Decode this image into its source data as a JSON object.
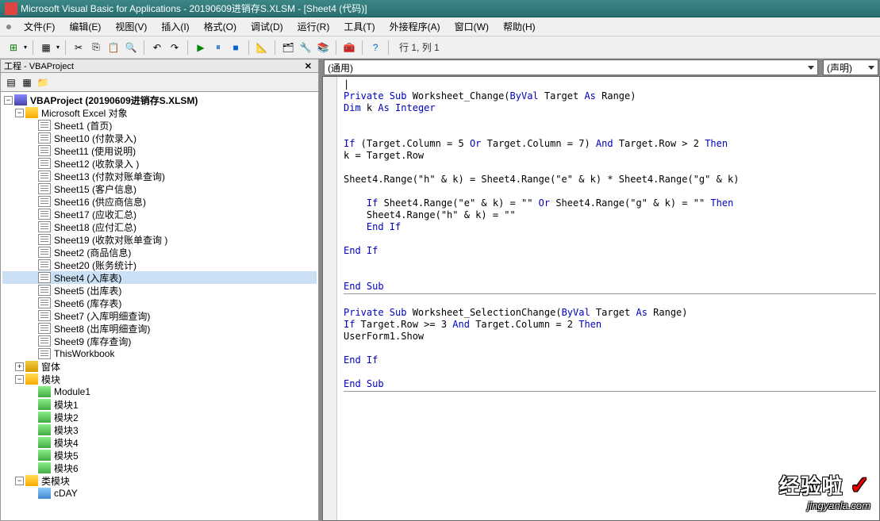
{
  "title": "Microsoft Visual Basic for Applications - 20190609进销存S.XLSM - [Sheet4 (代码)]",
  "menu": [
    "文件(F)",
    "编辑(E)",
    "视图(V)",
    "插入(I)",
    "格式(O)",
    "调试(D)",
    "运行(R)",
    "工具(T)",
    "外接程序(A)",
    "窗口(W)",
    "帮助(H)"
  ],
  "cursor_pos": "行 1, 列 1",
  "project_panel_title": "工程 - VBAProject",
  "tree": {
    "root": "VBAProject (20190609进销存S.XLSM)",
    "excel_objects": "Microsoft Excel 对象",
    "sheets": [
      "Sheet1 (首页)",
      "Sheet10 (付款录入)",
      "Sheet11 (使用说明)",
      "Sheet12 (收款录入 )",
      "Sheet13 (付款对账单查询)",
      "Sheet15 (客户信息)",
      "Sheet16 (供应商信息)",
      "Sheet17 (应收汇总)",
      "Sheet18 (应付汇总)",
      "Sheet19 (收款对账单查询 )",
      "Sheet2 (商品信息)",
      "Sheet20 (账务统计)",
      "Sheet4 (入库表)",
      "Sheet5 (出库表)",
      "Sheet6 (库存表)",
      "Sheet7 (入库明细查询)",
      "Sheet8 (出库明细查询)",
      "Sheet9 (库存查询)"
    ],
    "thisworkbook": "ThisWorkbook",
    "forms": "窗体",
    "modules_folder": "模块",
    "modules": [
      "Module1",
      "模块1",
      "模块2",
      "模块3",
      "模块4",
      "模块5",
      "模块6"
    ],
    "class_folder": "类模块",
    "classes": [
      "cDAY"
    ]
  },
  "dropdown_left": "(通用)",
  "dropdown_right": "(声明)",
  "code": {
    "l1": "Private Sub",
    "l1b": " Worksheet_Change(",
    "l1c": "ByVal",
    "l1d": " Target ",
    "l1e": "As",
    "l1f": " Range)",
    "l2": "Dim",
    "l2b": " k ",
    "l2c": "As Integer",
    "l3": "If",
    "l3b": " (Target.Column = 5 ",
    "l3c": "Or",
    "l3d": " Target.Column = 7) ",
    "l3e": "And",
    "l3f": " Target.Row > 2 ",
    "l3g": "Then",
    "l4": "k = Target.Row",
    "l5": "Sheet4.Range(\"h\" & k) = Sheet4.Range(\"e\" & k) * Sheet4.Range(\"g\" & k)",
    "l6a": "If",
    "l6b": " Sheet4.Range(\"e\" & k) = \"\" ",
    "l6c": "Or",
    "l6d": " Sheet4.Range(\"g\" & k) = \"\" ",
    "l6e": "Then",
    "l7": "Sheet4.Range(\"h\" & k) = \"\"",
    "l8": "End If",
    "l9": "End If",
    "l10": "End Sub",
    "l11a": "Private Sub",
    "l11b": " Worksheet_SelectionChange(",
    "l11c": "ByVal",
    "l11d": " Target ",
    "l11e": "As",
    "l11f": " Range)",
    "l12a": "If",
    "l12b": " Target.Row >= 3 ",
    "l12c": "And",
    "l12d": " Target.Column = 2 ",
    "l12e": "Then",
    "l13": "UserForm1.Show",
    "l14": "End If",
    "l15": "End Sub"
  },
  "watermark_main": "经验啦",
  "watermark_sub": "jingyanla.com"
}
